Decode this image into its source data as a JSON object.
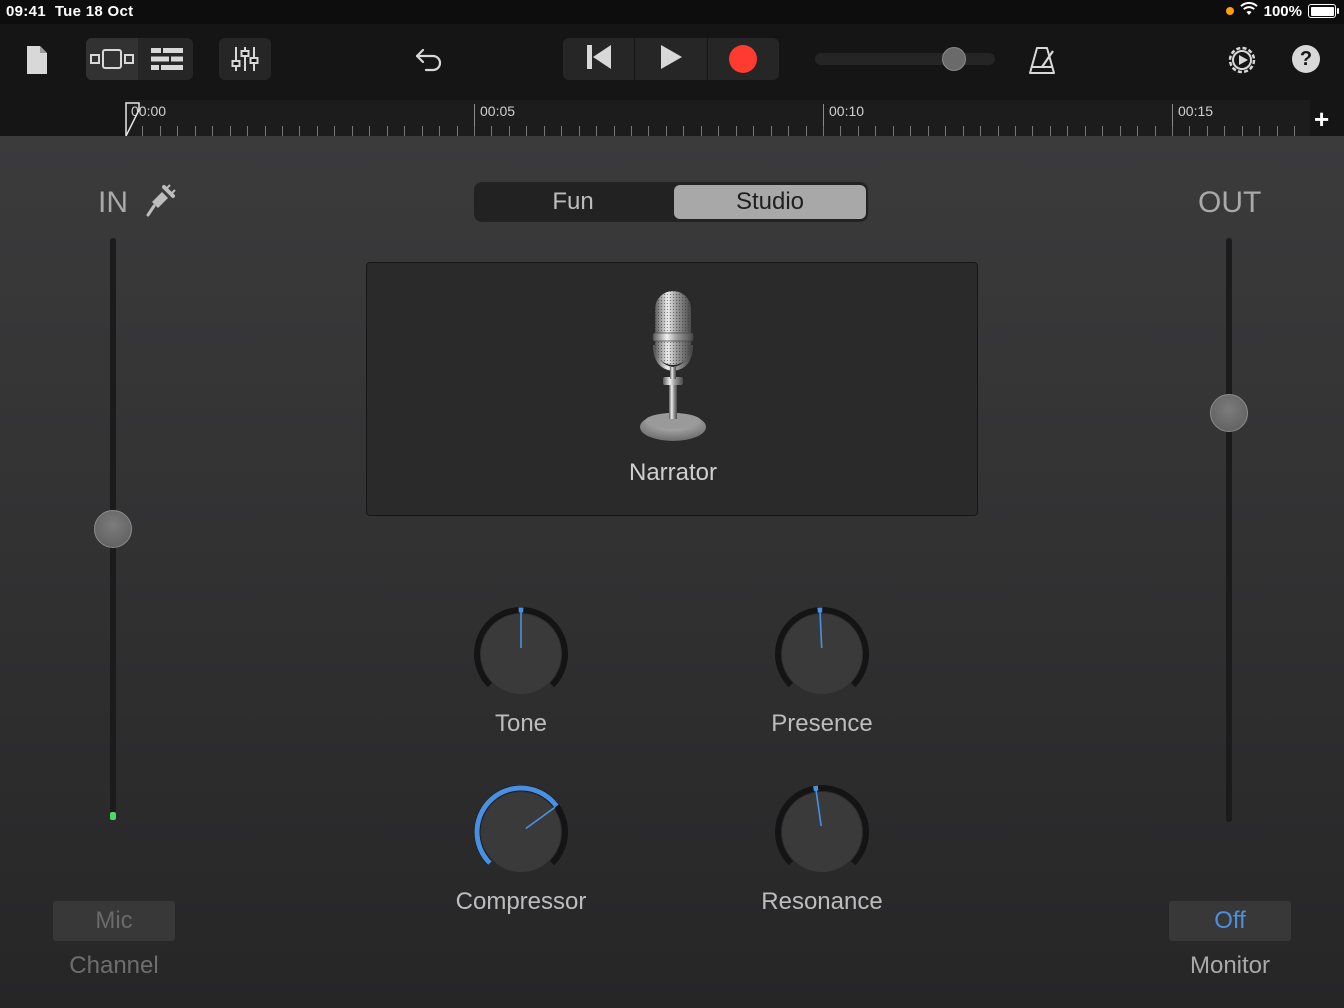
{
  "status_bar": {
    "time": "09:41",
    "date": "Tue 18 Oct",
    "battery": "100%"
  },
  "toolbar": {
    "icons": [
      "document-icon",
      "tracks-view-icon",
      "list-view-icon",
      "mixer-icon",
      "undo-icon",
      "rewind-icon",
      "play-icon",
      "record-icon",
      "metronome-icon",
      "settings-icon",
      "help-icon"
    ],
    "help_glyph": "?",
    "master_volume_fraction": 0.77,
    "record_color": "#ff3b30"
  },
  "ruler": {
    "labels": [
      "00:00",
      "00:05",
      "00:10",
      "00:15"
    ],
    "add_glyph": "+"
  },
  "main": {
    "in_label": "IN",
    "out_label": "OUT",
    "tabs": [
      {
        "label": "Fun",
        "selected": false
      },
      {
        "label": "Studio",
        "selected": true
      }
    ],
    "preset": {
      "name": "Narrator"
    },
    "input_level_fraction": 0.5,
    "output_level_fraction": 0.7,
    "knobs": [
      {
        "label": "Tone",
        "value": 0.5
      },
      {
        "label": "Presence",
        "value": 0.49
      },
      {
        "label": "Compressor",
        "value": 0.7
      },
      {
        "label": "Resonance",
        "value": 0.47
      }
    ],
    "accent_color": "#4a90e2",
    "mic_button": {
      "label": "Mic",
      "caption": "Channel"
    },
    "monitor_button": {
      "label": "Off",
      "caption": "Monitor"
    }
  }
}
